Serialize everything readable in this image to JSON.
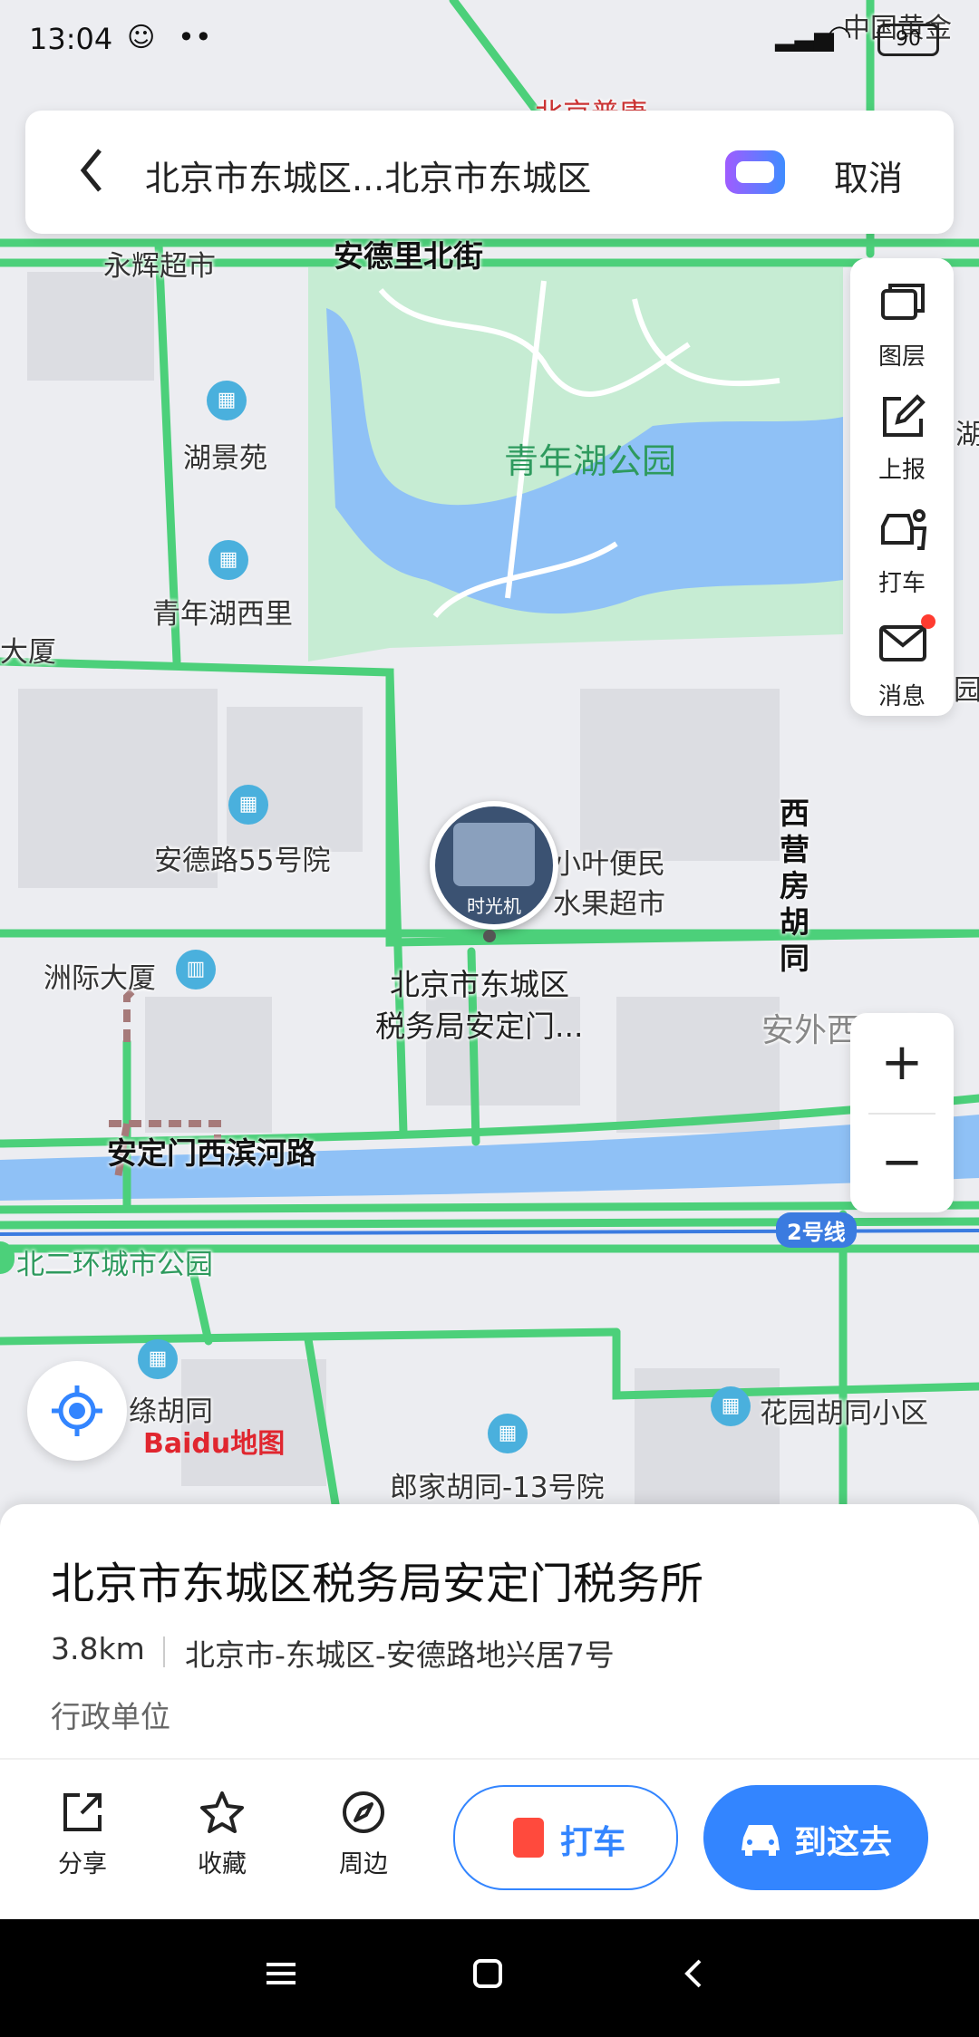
{
  "status_bar": {
    "time": "13:04",
    "dots": "••",
    "battery": "90"
  },
  "search_bar": {
    "route_text": "北京市东城区...北京市东城区",
    "cancel_label": "取消"
  },
  "tools": [
    {
      "label": "图层",
      "icon": "layers-icon"
    },
    {
      "label": "上报",
      "icon": "report-icon"
    },
    {
      "label": "打车",
      "icon": "taxi-icon"
    },
    {
      "label": "消息",
      "icon": "mail-icon"
    }
  ],
  "map": {
    "top_partial": "中国黄金",
    "top_poi": "北京普康",
    "roads": [
      "安德里北街",
      "安定门西滨河路",
      "西营房胡同",
      "安外西河沿"
    ],
    "park": "青年湖公园",
    "park2": "北二环城市公园",
    "metro_line": "2号线",
    "pois": [
      {
        "name": "永辉超市"
      },
      {
        "name": "湖景苑"
      },
      {
        "name": "青年湖西里"
      },
      {
        "name": "安德路55号院"
      },
      {
        "name": "洲际大厦"
      },
      {
        "name": "小叶便民"
      },
      {
        "name": "水果超市"
      },
      {
        "name": "花园胡同小区"
      },
      {
        "name": "郎家胡同-13号院"
      },
      {
        "name": "绦胡同"
      }
    ],
    "partial_left": "大厦",
    "partial_right1": "湖",
    "partial_right2": "园",
    "marker_badge": "时光机",
    "marker_name_line1": "北京市东城区",
    "marker_name_line2": "税务局安定门...",
    "logo": "Baidu地图",
    "zoom_in": "+",
    "zoom_out": "−"
  },
  "place_card": {
    "title": "北京市东城区税务局安定门税务所",
    "distance": "3.8km",
    "address": "北京市-东城区-安德路地兴居7号",
    "category": "行政单位"
  },
  "actions": {
    "share": "分享",
    "favorite": "收藏",
    "nearby": "周边",
    "taxi": "打车",
    "go": "到这去"
  },
  "colors": {
    "accent": "#3385ff",
    "road_green": "#4cd07a",
    "park": "#c6ecd3",
    "water": "#8fc1f6"
  }
}
